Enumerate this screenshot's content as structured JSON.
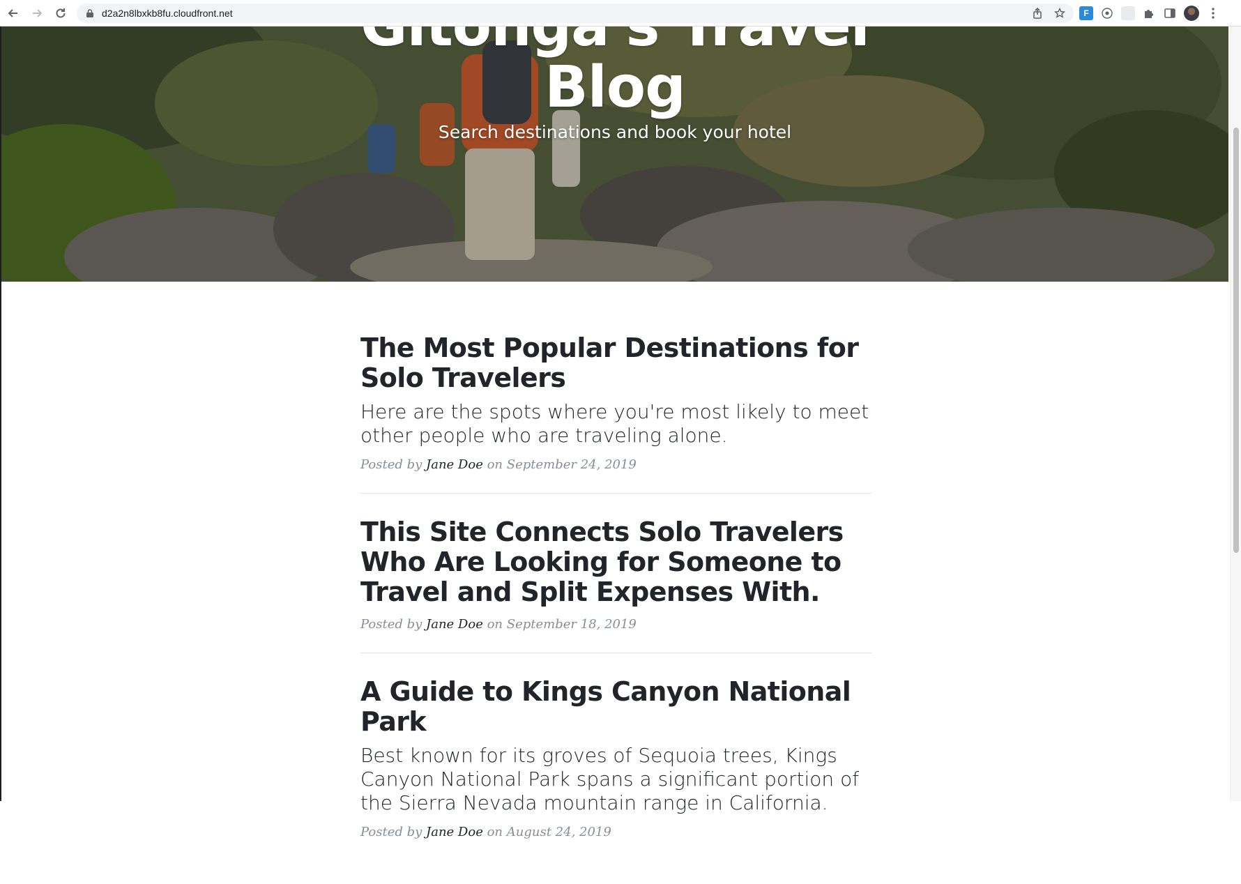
{
  "browser": {
    "url": "d2a2n8lbxkb8fu.cloudfront.net",
    "icons": {
      "back": "back-arrow-icon",
      "forward": "forward-arrow-icon",
      "reload": "reload-icon",
      "lock": "lock-icon",
      "share": "share-icon",
      "bookmark": "star-icon",
      "extensions": "puzzle-icon",
      "sidepanel": "side-panel-icon",
      "menu": "kebab-menu-icon"
    }
  },
  "hero": {
    "title_line1": "Gitonga's Travel",
    "title_line2": "Blog",
    "subtitle": "Search destinations and book your hotel"
  },
  "posts": [
    {
      "title": "The Most Popular Destinations for Solo Travelers",
      "subtitle": "Here are the spots where you're most likely to meet other people who are traveling alone.",
      "posted_by": "Posted by",
      "author": "Jane Doe",
      "on": "on",
      "date": "September 24, 2019"
    },
    {
      "title": "This Site Connects Solo Travelers Who Are Looking for Someone to Travel and Split Expenses With.",
      "subtitle": "",
      "posted_by": "Posted by",
      "author": "Jane Doe",
      "on": "on",
      "date": "September 18, 2019"
    },
    {
      "title": "A Guide to Kings Canyon National Park",
      "subtitle": "Best known for its groves of Sequoia trees, Kings Canyon National Park spans a significant portion of the Sierra Nevada mountain range in California.",
      "posted_by": "Posted by",
      "author": "Jane Doe",
      "on": "on",
      "date": "August 24, 2019"
    }
  ],
  "colors": {
    "heading": "#212529",
    "meta": "#868e96",
    "divider": "#e3e3e3"
  }
}
